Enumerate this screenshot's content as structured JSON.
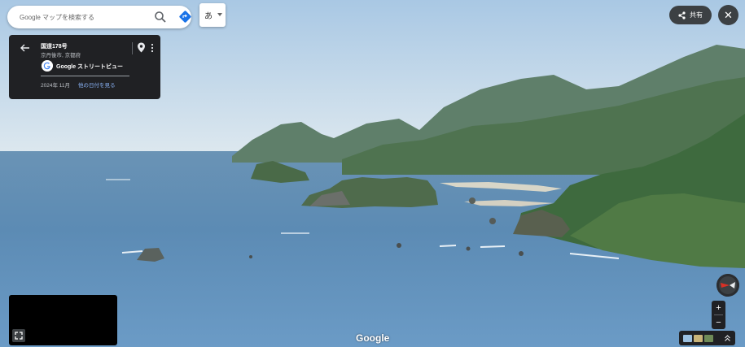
{
  "search": {
    "placeholder": "Google マップを検索する"
  },
  "lang_button": {
    "label": "あ"
  },
  "share": {
    "label": "共有"
  },
  "info_card": {
    "title": "国道178号",
    "subtitle": "京丹後市, 京都府",
    "source": "Google ストリートビュー",
    "date": "2024年 11月",
    "other_dates_link": "他の日付を見る"
  },
  "brand": "Google",
  "zoom": {
    "in": "+",
    "out": "−"
  },
  "icons": {
    "search": "search-icon",
    "directions": "directions-icon",
    "share": "share-icon",
    "close": "close-icon",
    "back": "back-arrow-icon",
    "pin": "location-pin-icon",
    "more": "more-vert-icon",
    "expand": "fullscreen-icon",
    "compass": "compass-icon",
    "collapse": "chevron-up-icon"
  },
  "colors": {
    "panel": "#202124",
    "link": "#8ab4f8",
    "directions": "#1a73e8",
    "compass_needle": "#d93025"
  }
}
